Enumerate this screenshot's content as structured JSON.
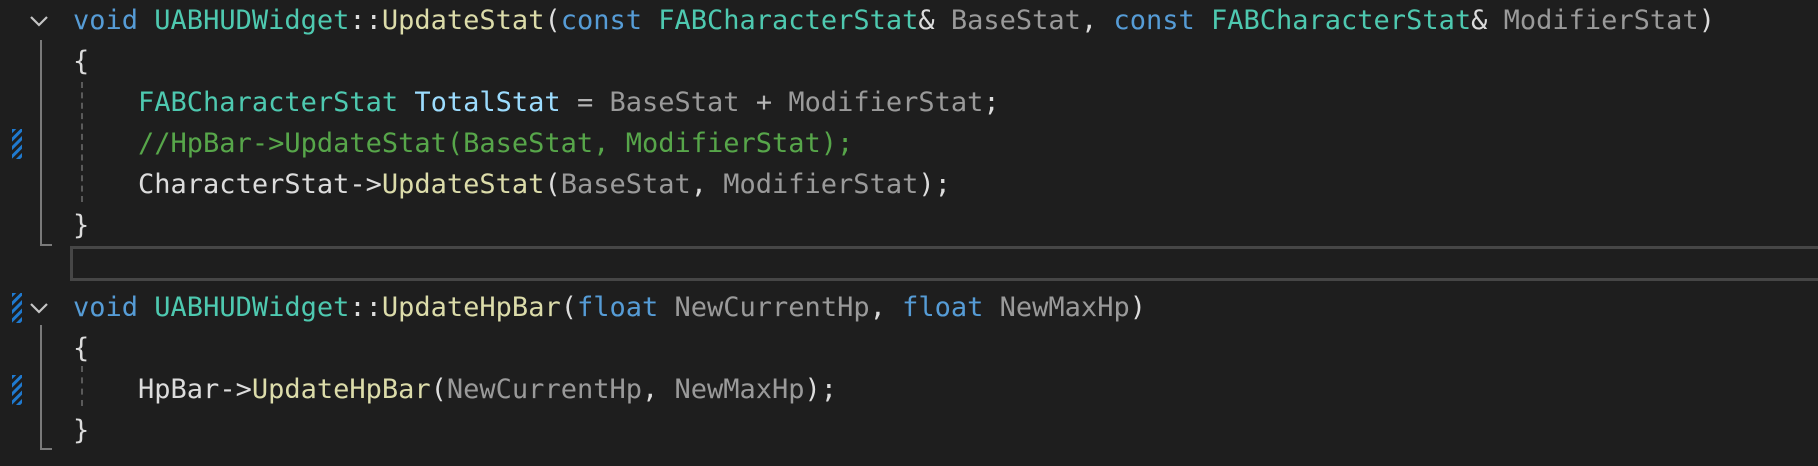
{
  "editor": {
    "colors": {
      "background": "#1e1e1e",
      "keyword": "#569cd6",
      "type": "#4ec9b0",
      "function": "#dcdcaa",
      "comment": "#57a64a",
      "change_marker": "#1f7ad0"
    },
    "lines": [
      {
        "tokens": [
          "void",
          " ",
          "UABHUDWidget",
          "::",
          "UpdateStat",
          "(",
          "const",
          " ",
          "FABCharacterStat",
          "&",
          " ",
          "BaseStat",
          ", ",
          "const",
          " ",
          "FABCharacterStat",
          "&",
          " ",
          "ModifierStat",
          ")"
        ]
      },
      {
        "tokens": [
          "{"
        ]
      },
      {
        "tokens": [
          "    ",
          "FABCharacterStat",
          " ",
          "TotalStat",
          " ",
          "=",
          " ",
          "BaseStat",
          " ",
          "+",
          " ",
          "ModifierStat",
          ";"
        ]
      },
      {
        "tokens": [
          "    ",
          "//HpBar->UpdateStat(BaseStat, ModifierStat);"
        ]
      },
      {
        "tokens": [
          "    ",
          "CharacterStat",
          "->",
          "UpdateStat",
          "(",
          "BaseStat",
          ", ",
          "ModifierStat",
          ");"
        ]
      },
      {
        "tokens": [
          "}"
        ]
      },
      {
        "tokens": [
          ""
        ]
      },
      {
        "tokens": [
          "void",
          " ",
          "UABHUDWidget",
          "::",
          "UpdateHpBar",
          "(",
          "float",
          " ",
          "NewCurrentHp",
          ", ",
          "float",
          " ",
          "NewMaxHp",
          ")"
        ]
      },
      {
        "tokens": [
          "{"
        ]
      },
      {
        "tokens": [
          "    ",
          "HpBar",
          "->",
          "UpdateHpBar",
          "(",
          "NewCurrentHp",
          ", ",
          "NewMaxHp",
          ");"
        ]
      },
      {
        "tokens": [
          "}"
        ]
      }
    ],
    "fold_icons": [
      "chevron-down",
      "chevron-down"
    ],
    "change_markers": [
      "modified",
      "modified",
      "modified"
    ]
  }
}
